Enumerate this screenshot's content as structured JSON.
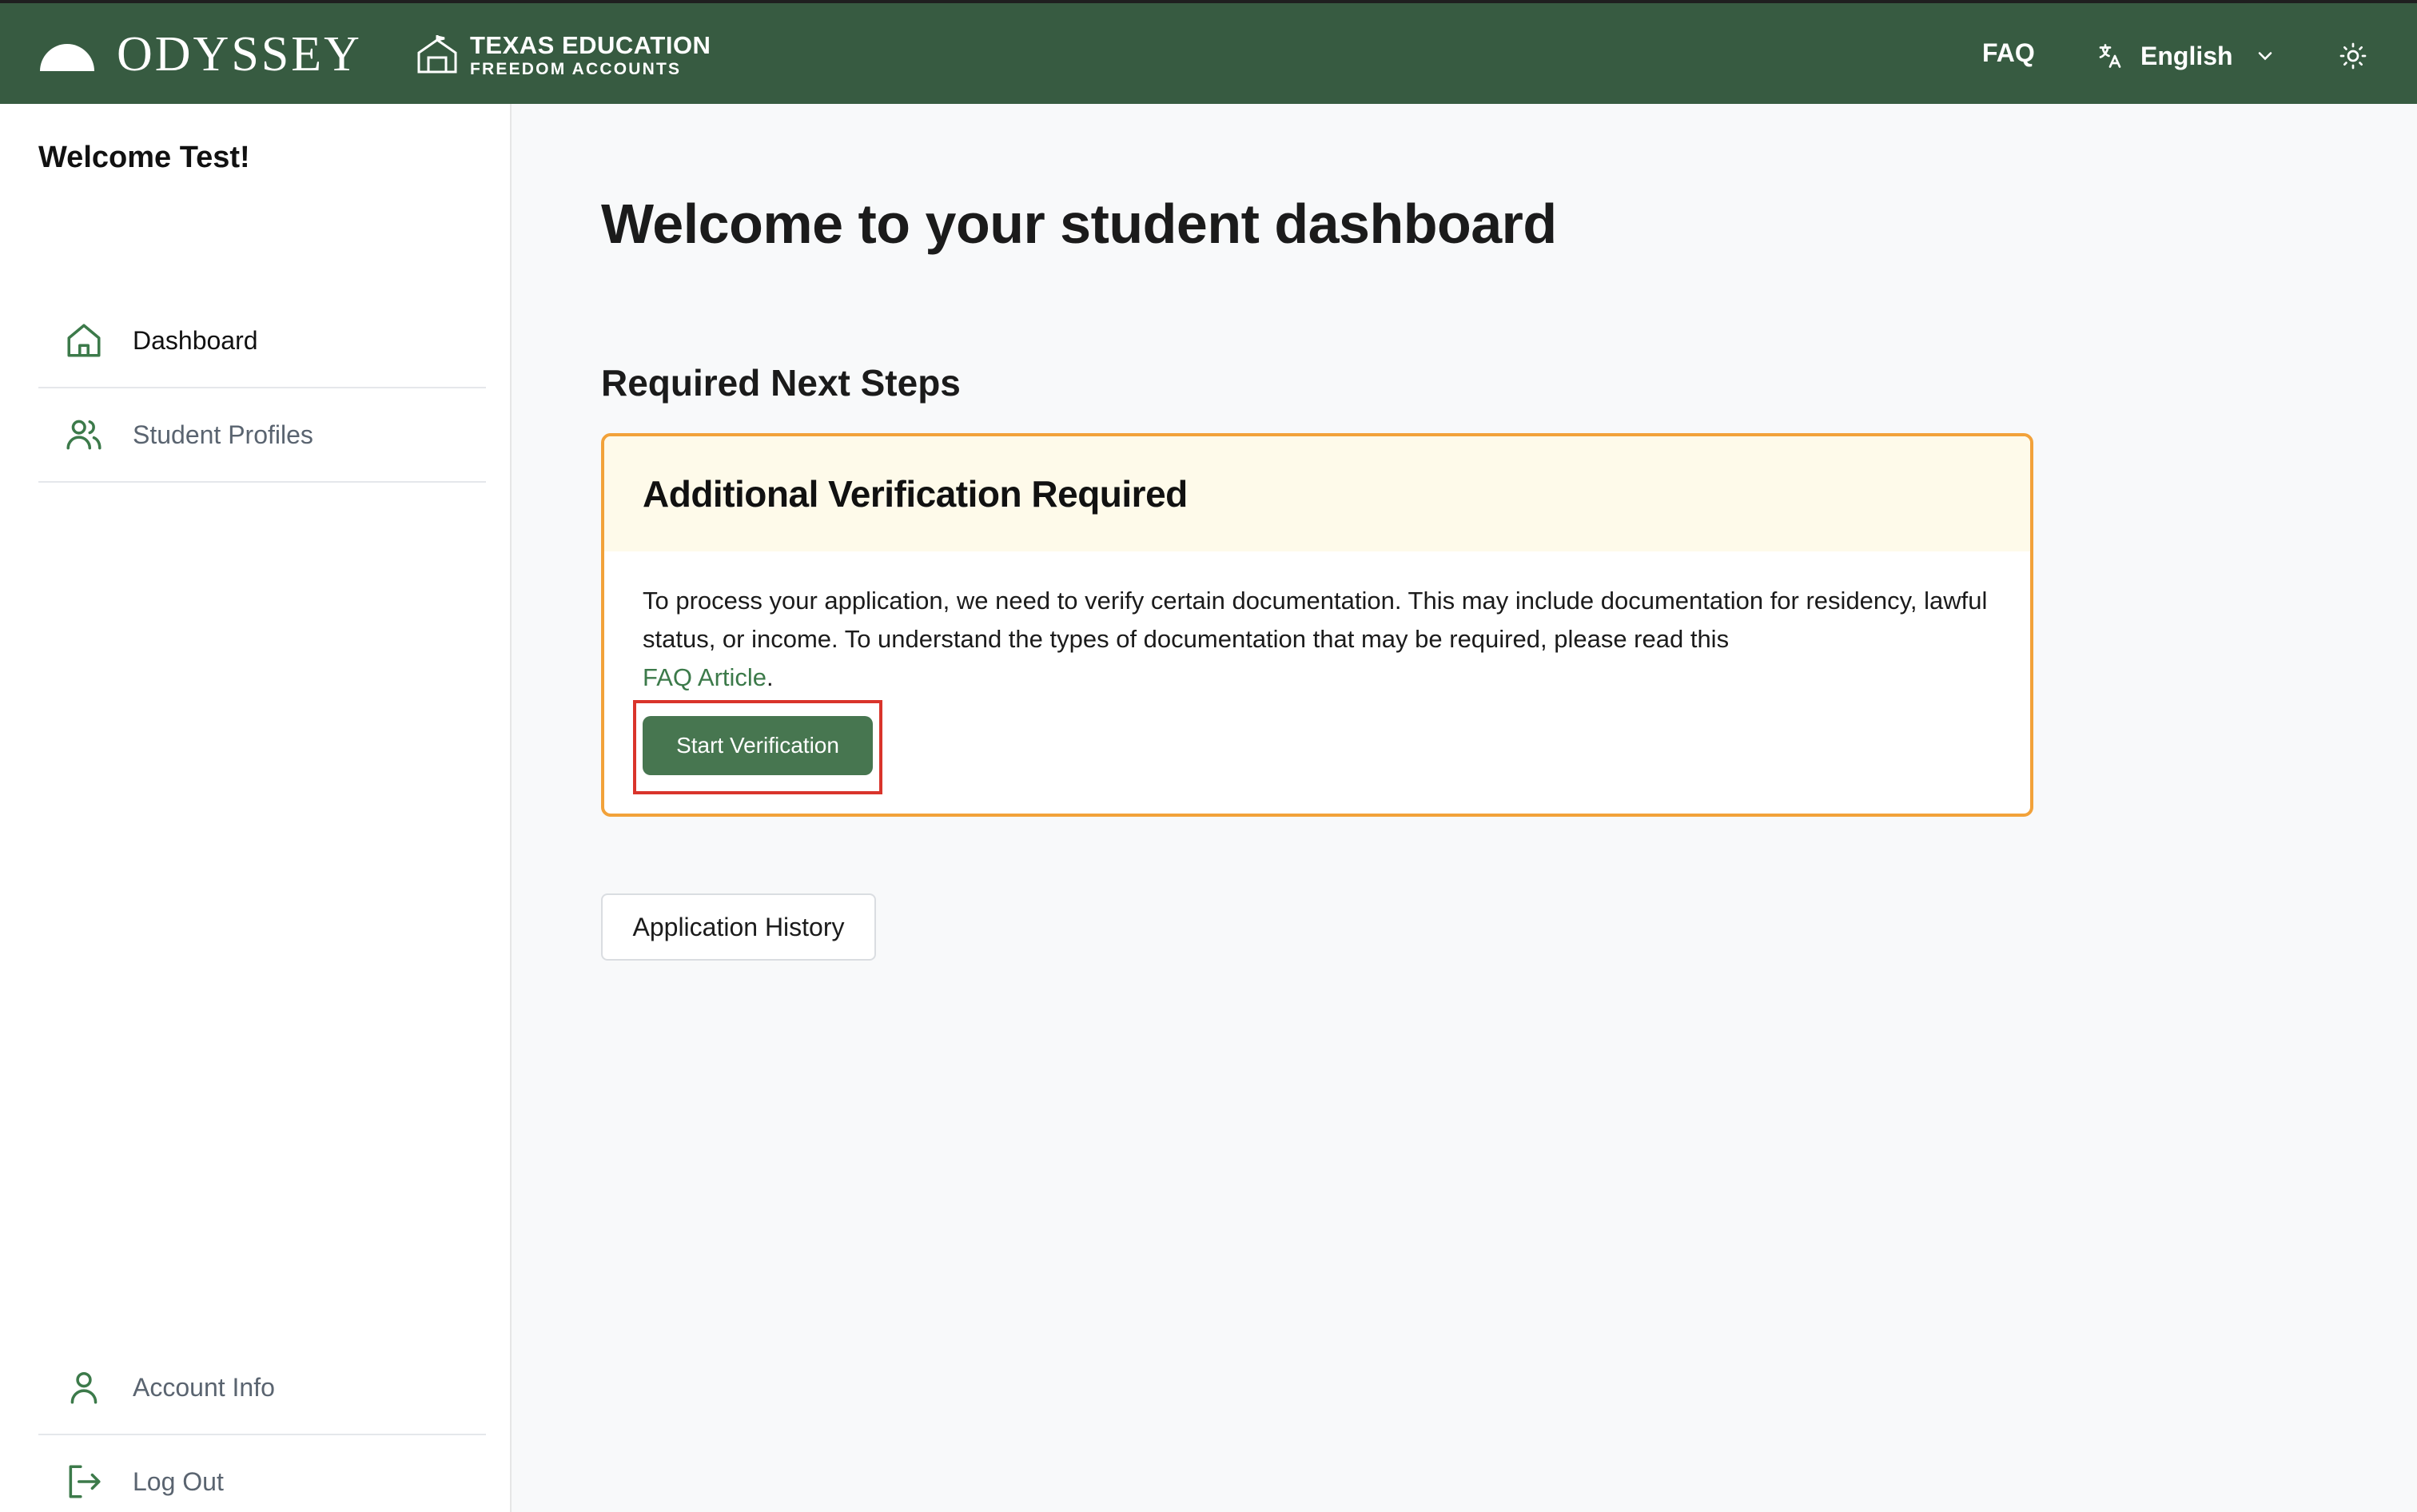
{
  "header": {
    "brand": "ODYSSEY",
    "partner_line1": "TEXAS EDUCATION",
    "partner_line2": "FREEDOM ACCOUNTS",
    "faq_label": "FAQ",
    "language_label": "English",
    "color_bg": "#375b41"
  },
  "sidebar": {
    "welcome": "Welcome Test!",
    "items": [
      {
        "label": "Dashboard",
        "icon": "home-icon",
        "active": true
      },
      {
        "label": "Student Profiles",
        "icon": "users-icon",
        "active": false
      },
      {
        "label": "Account Info",
        "icon": "user-icon",
        "active": false
      },
      {
        "label": "Log Out",
        "icon": "logout-icon",
        "active": false
      }
    ]
  },
  "main": {
    "title": "Welcome to your student dashboard",
    "section_title": "Required Next Steps",
    "card": {
      "title": "Additional Verification Required",
      "body": "To process your application, we need to verify certain documentation. This may include documentation for residency, lawful status, or income. To understand the types of documentation that may be required, please read this",
      "link": "FAQ Article",
      "suffix": ".",
      "button": "Start Verification",
      "border_color": "#f2a23a"
    },
    "history_button": "Application History"
  }
}
